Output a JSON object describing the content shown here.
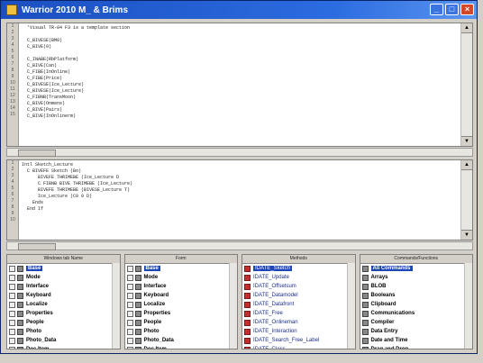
{
  "window": {
    "title": "Warrior 2010 M_ & Brims"
  },
  "editor_top": {
    "lines": [
      "  'Visual TR-04 F3 is a template section",
      "",
      "  C_BIVESE(BM0)",
      "  C_BIVE(0)",
      "",
      "  C_INABE(RbPlatform)",
      "  C_BIVE(Can)",
      "  C_FIBE(InOnline)",
      "  C_FIBE(Price)",
      "  C_BIVESE(Ice_Lecture)",
      "  C_BIVESE(Ice_Lecture)",
      "  C_FIBNB(TransMoon)",
      "  C_BIVE(Onmens)",
      "  C_BIVE(Pairs)",
      "  C_BIVE(InOnlinerm)"
    ]
  },
  "editor_bottom": {
    "lines": [
      "Intl Sketch_Lecture",
      "  C BIVEFE Sketch (Bo)",
      "      BIVEFE THRIMEBE (Ice_Lecture D",
      "      C FIBNB BIVE THRIMEBE (Ice_Lecture)",
      "      BIVEFE THRIMEBE (BIVESE_Lecture T)",
      "      Ice_Lecture (C0 0 D)",
      "    Ends",
      "  End If"
    ]
  },
  "lists": [
    {
      "header": "Windows tab Name",
      "rows": [
        {
          "label": "Base",
          "selected": true
        },
        {
          "label": "Mode",
          "selected": false
        },
        {
          "label": "Interface",
          "selected": false
        },
        {
          "label": "Keyboard",
          "selected": false
        },
        {
          "label": "Localize",
          "selected": false
        },
        {
          "label": "Properties",
          "selected": false
        },
        {
          "label": "People",
          "selected": false
        },
        {
          "label": "Photo",
          "selected": false
        },
        {
          "label": "Photo_Data",
          "selected": false
        },
        {
          "label": "Doc Item",
          "selected": false
        }
      ]
    },
    {
      "header": "Form",
      "rows": [
        {
          "label": "Base",
          "selected": true
        },
        {
          "label": "Mode",
          "selected": false
        },
        {
          "label": "Interface",
          "selected": false
        },
        {
          "label": "Keyboard",
          "selected": false
        },
        {
          "label": "Localize",
          "selected": false
        },
        {
          "label": "Properties",
          "selected": false
        },
        {
          "label": "People",
          "selected": false
        },
        {
          "label": "Photo",
          "selected": false
        },
        {
          "label": "Photo_Data",
          "selected": false
        },
        {
          "label": "Doc Item",
          "selected": false
        }
      ]
    },
    {
      "header": "Methods",
      "rows": [
        {
          "label": "IDATE_Sketch",
          "selected": true
        },
        {
          "label": "IDATE_Update",
          "selected": false
        },
        {
          "label": "IDATE_Offsetsum",
          "selected": false
        },
        {
          "label": "IDATE_Datamodel",
          "selected": false
        },
        {
          "label": "IDATE_Datafront",
          "selected": false
        },
        {
          "label": "IDATE_Free",
          "selected": false
        },
        {
          "label": "IDATE_Onlineman",
          "selected": false
        },
        {
          "label": "IDATE_Interaction",
          "selected": false
        },
        {
          "label": "IDATE_Search_Free_Label",
          "selected": false
        },
        {
          "label": "IDATE_Class",
          "selected": false
        }
      ]
    },
    {
      "header": "Commands/Functions",
      "rows": [
        {
          "label": "All Commands",
          "selected": true
        },
        {
          "label": "Arrays",
          "selected": false
        },
        {
          "label": "BLOB",
          "selected": false
        },
        {
          "label": "Booleans",
          "selected": false
        },
        {
          "label": "Clipboard",
          "selected": false
        },
        {
          "label": "Communications",
          "selected": false
        },
        {
          "label": "Compiler",
          "selected": false
        },
        {
          "label": "Data Entry",
          "selected": false
        },
        {
          "label": "Date and Time",
          "selected": false
        },
        {
          "label": "Drag and Drop",
          "selected": false
        }
      ]
    }
  ]
}
